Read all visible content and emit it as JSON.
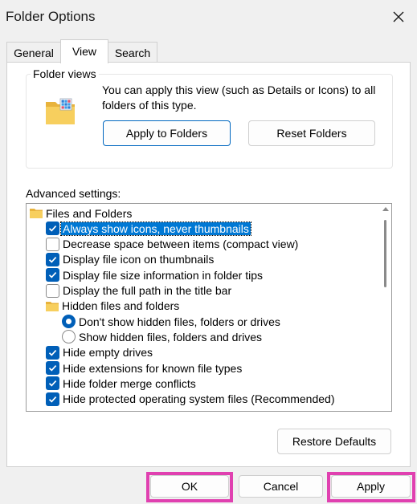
{
  "window": {
    "title": "Folder Options"
  },
  "tabs": [
    {
      "label": "General",
      "active": false
    },
    {
      "label": "View",
      "active": true
    },
    {
      "label": "Search",
      "active": false
    }
  ],
  "folder_views": {
    "legend": "Folder views",
    "description": "You can apply this view (such as Details or Icons) to all folders of this type.",
    "apply_label": "Apply to Folders",
    "reset_label": "Reset Folders"
  },
  "advanced": {
    "label": "Advanced settings:",
    "items": [
      {
        "kind": "folder",
        "label": "Files and Folders",
        "indent": 0
      },
      {
        "kind": "checkbox",
        "checked": true,
        "selected": true,
        "label": "Always show icons, never thumbnails",
        "indent": 1
      },
      {
        "kind": "checkbox",
        "checked": false,
        "label": "Decrease space between items (compact view)",
        "indent": 1
      },
      {
        "kind": "checkbox",
        "checked": true,
        "label": "Display file icon on thumbnails",
        "indent": 1
      },
      {
        "kind": "checkbox",
        "checked": true,
        "label": "Display file size information in folder tips",
        "indent": 1
      },
      {
        "kind": "checkbox",
        "checked": false,
        "label": "Display the full path in the title bar",
        "indent": 1
      },
      {
        "kind": "folder",
        "label": "Hidden files and folders",
        "indent": 1
      },
      {
        "kind": "radio",
        "checked": true,
        "label": "Don't show hidden files, folders or drives",
        "indent": 2
      },
      {
        "kind": "radio",
        "checked": false,
        "label": "Show hidden files, folders and drives",
        "indent": 2
      },
      {
        "kind": "checkbox",
        "checked": true,
        "label": "Hide empty drives",
        "indent": 1
      },
      {
        "kind": "checkbox",
        "checked": true,
        "label": "Hide extensions for known file types",
        "indent": 1
      },
      {
        "kind": "checkbox",
        "checked": true,
        "label": "Hide folder merge conflicts",
        "indent": 1
      },
      {
        "kind": "checkbox",
        "checked": true,
        "label": "Hide protected operating system files (Recommended)",
        "indent": 1
      }
    ],
    "restore_label": "Restore Defaults"
  },
  "footer": {
    "ok_label": "OK",
    "cancel_label": "Cancel",
    "apply_label": "Apply"
  },
  "colors": {
    "accent": "#005fb8",
    "highlight": "#e040b0"
  }
}
